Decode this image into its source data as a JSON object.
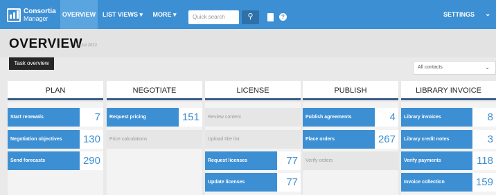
{
  "app": {
    "logo_top": "Consortia",
    "logo_bottom": "Manager"
  },
  "nav": {
    "overview": "OVERVIEW",
    "list_views": "LIST VIEWS ▾",
    "more": "MORE ▾",
    "search_placeholder": "Quick search",
    "settings": "SETTINGS",
    "settings_chevron": "⌄"
  },
  "header": {
    "title": "OVERVIEW",
    "date": "22 Jul 2022",
    "task_button": "Task overview"
  },
  "filter": {
    "contacts_value": "All contacts",
    "chevron": "⌄"
  },
  "icons": {
    "search": "search-icon",
    "book": "book-icon",
    "help": "help-icon"
  },
  "colors": {
    "accent": "#3d8fd3",
    "dark": "#262626"
  },
  "columns": [
    {
      "title": "PLAN",
      "tiles": [
        {
          "label": "Start renewals",
          "count": "7"
        },
        {
          "label": "Negotiation objectives",
          "count": "130"
        },
        {
          "label": "Send forecasts",
          "count": "290"
        }
      ]
    },
    {
      "title": "NEGOTIATE",
      "tiles": [
        {
          "label": "Request pricing",
          "count": "151"
        },
        {
          "label": "Price calculations"
        }
      ]
    },
    {
      "title": "LICENSE",
      "tiles": [
        {
          "label": "Review content"
        },
        {
          "label": "Upload title list"
        },
        {
          "label": "Request licenses",
          "count": "77"
        },
        {
          "label": "Update licenses",
          "count": "77"
        }
      ]
    },
    {
      "title": "PUBLISH",
      "tiles": [
        {
          "label": "Publish agreements",
          "count": "4"
        },
        {
          "label": "Place orders",
          "count": "267"
        },
        {
          "label": "Verify orders"
        }
      ]
    },
    {
      "title": "LIBRARY INVOICE",
      "tiles": [
        {
          "label": "Library invoices",
          "count": "8"
        },
        {
          "label": "Library credit notes",
          "count": "3"
        },
        {
          "label": "Verify payments",
          "count": "118"
        },
        {
          "label": "Invoice collection",
          "count": "159"
        }
      ]
    }
  ]
}
